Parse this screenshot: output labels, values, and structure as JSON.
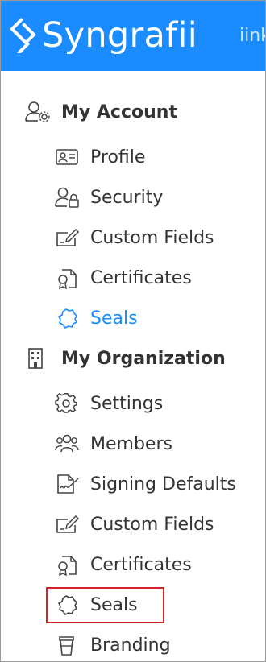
{
  "header": {
    "brand": "Syngrafii",
    "extra_text": "iink"
  },
  "colors": {
    "brand_blue": "#1a8cff",
    "text": "#333333",
    "highlight_red": "#d6202a"
  },
  "my_account": {
    "title": "My Account",
    "icon": "user-gear-icon",
    "items": [
      {
        "label": "Profile",
        "icon": "id-card-icon",
        "active": false
      },
      {
        "label": "Security",
        "icon": "user-lock-icon",
        "active": false
      },
      {
        "label": "Custom Fields",
        "icon": "edit-field-icon",
        "active": false
      },
      {
        "label": "Certificates",
        "icon": "certificate-icon",
        "active": false
      },
      {
        "label": "Seals",
        "icon": "seal-icon",
        "active": true
      }
    ]
  },
  "my_organization": {
    "title": "My Organization",
    "icon": "building-icon",
    "items": [
      {
        "label": "Settings",
        "icon": "gear-icon",
        "active": false
      },
      {
        "label": "Members",
        "icon": "users-icon",
        "active": false
      },
      {
        "label": "Signing Defaults",
        "icon": "signature-doc-icon",
        "active": false
      },
      {
        "label": "Custom Fields",
        "icon": "edit-field-icon",
        "active": false
      },
      {
        "label": "Certificates",
        "icon": "certificate-icon",
        "active": false
      },
      {
        "label": "Seals",
        "icon": "seal-icon",
        "active": false,
        "highlighted": true
      },
      {
        "label": "Branding",
        "icon": "cup-icon",
        "active": false
      }
    ]
  }
}
